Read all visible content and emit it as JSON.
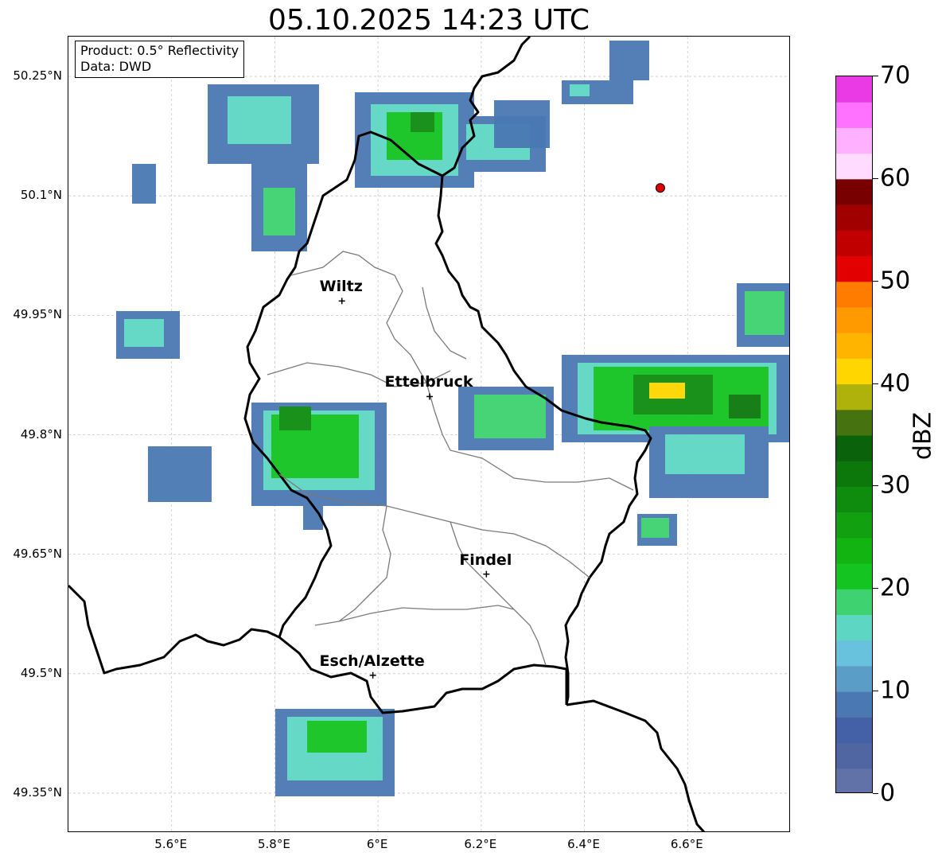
{
  "title": "05.10.2025 14:23 UTC",
  "info": {
    "product": "Product: 0.5° Reflectivity",
    "data": "Data: DWD"
  },
  "map": {
    "lon_range": [
      5.4,
      6.8
    ],
    "lat_range": [
      49.3,
      50.3
    ],
    "lat_ticks": [
      "50.25°N",
      "50.1°N",
      "49.95°N",
      "49.8°N",
      "49.65°N",
      "49.5°N",
      "49.35°N"
    ],
    "lon_ticks": [
      "5.6°E",
      "5.8°E",
      "6°E",
      "6.2°E",
      "6.4°E",
      "6.6°E"
    ],
    "lat_values": [
      50.25,
      50.1,
      49.95,
      49.8,
      49.65,
      49.5,
      49.35
    ],
    "lon_values": [
      5.6,
      5.8,
      6.0,
      6.2,
      6.4,
      6.6
    ],
    "grid": true,
    "marker": {
      "lon": 6.547,
      "lat": 50.11,
      "color": "#e00000"
    }
  },
  "cities": [
    {
      "name": "Wiltz",
      "lon": 5.93,
      "lat": 49.968
    },
    {
      "name": "Ettelbruck",
      "lon": 6.1,
      "lat": 49.848
    },
    {
      "name": "Findel",
      "lon": 6.21,
      "lat": 49.625
    },
    {
      "name": "Esch/Alzette",
      "lon": 5.99,
      "lat": 49.498
    }
  ],
  "colorbar": {
    "label": "dBZ",
    "min": 0,
    "max": 70,
    "ticks": [
      "0",
      "10",
      "20",
      "30",
      "40",
      "50",
      "60",
      "70"
    ],
    "tick_values": [
      0,
      10,
      20,
      30,
      40,
      50,
      60,
      70
    ],
    "colors": [
      "#6072a8",
      "#5066a3",
      "#4460a6",
      "#4a78b3",
      "#5a9ec8",
      "#68c2de",
      "#5ed6c4",
      "#3ed270",
      "#14c420",
      "#12b412",
      "#10a010",
      "#0e8c0e",
      "#0c780c",
      "#0a620a",
      "#467210",
      "#aeb20a",
      "#ffd600",
      "#ffb400",
      "#ff9a00",
      "#ff7c00",
      "#e20000",
      "#c00000",
      "#a00000",
      "#780000",
      "#ffdcff",
      "#ffb0ff",
      "#ff72ff",
      "#ea3ae6"
    ]
  }
}
